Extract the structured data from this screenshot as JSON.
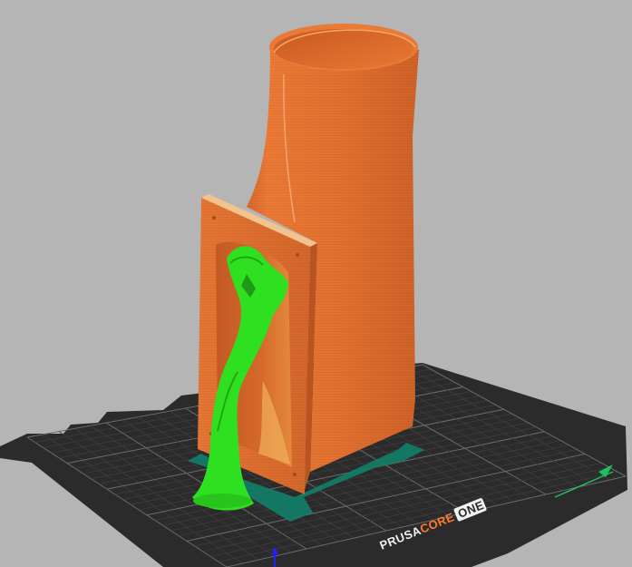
{
  "viewport": {
    "background": "#b5b5b5"
  },
  "bed": {
    "logo": {
      "brand": "PRUSA",
      "core": "CORE",
      "one": "ONE"
    },
    "colors": {
      "plate": "#2b2b2b",
      "grid_minor": "#3f3f3f",
      "grid_major": "#6b6b6b",
      "logo_core": "#ff7b2c"
    }
  },
  "objects": [
    {
      "name": "vase",
      "color": "#e2702f"
    },
    {
      "name": "panel",
      "color": "#e2702f"
    },
    {
      "name": "support",
      "color": "#2de022"
    }
  ],
  "axes": {
    "y_color": "#2020ff",
    "x_color": "#20c060"
  }
}
